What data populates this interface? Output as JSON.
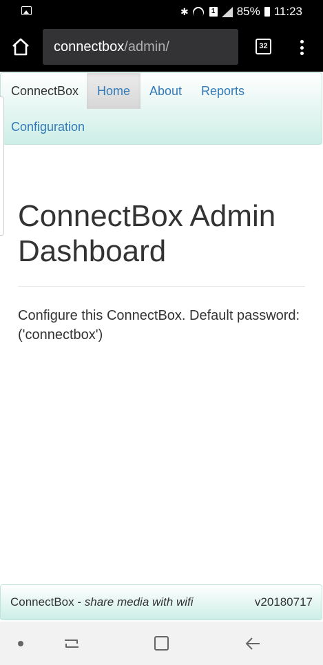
{
  "status_bar": {
    "battery": "85%",
    "time": "11:23",
    "sim_slot": "1",
    "icons": [
      "gallery-icon",
      "bluetooth-icon",
      "wifi-icon",
      "sim-icon",
      "signal-icon",
      "battery-icon"
    ]
  },
  "browser": {
    "url_host": "connectbox",
    "url_path": "/admin/",
    "tab_count": "32"
  },
  "navbar": {
    "brand": "ConnectBox",
    "items": [
      {
        "label": "Home",
        "active": true
      },
      {
        "label": "About"
      },
      {
        "label": "Reports"
      },
      {
        "label": "Configuration"
      }
    ]
  },
  "main": {
    "title": "ConnectBox Admin Dashboard",
    "lead": "Configure this ConnectBox. Default password: ('connectbox')"
  },
  "footer": {
    "brand": "ConnectBox",
    "separator": " - ",
    "tagline": "share media with wifi",
    "version": "v20180717"
  },
  "colors": {
    "link": "#337ab7",
    "navbar_gradient_end": "#cdeee6",
    "text": "#333333"
  }
}
